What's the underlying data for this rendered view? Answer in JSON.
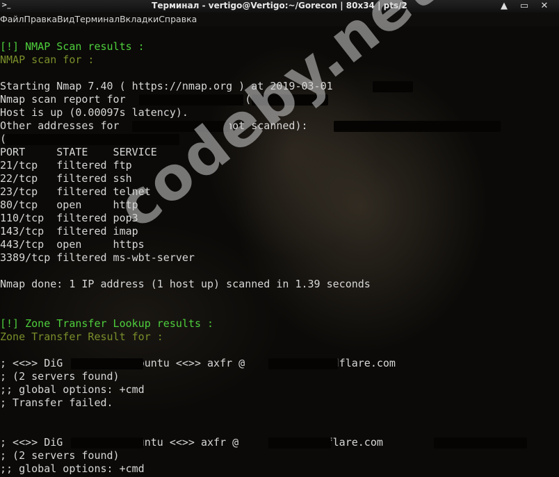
{
  "window": {
    "title": "Терминал - vertigo@Vertigo:~/Gorecon | 80x34 | pts/2",
    "icon": "terminal-icon",
    "controls": [
      "minimize-icon",
      "maximize-icon",
      "close-icon"
    ],
    "minimize_glyph": "▲",
    "maximize_glyph": "▭",
    "close_glyph": "✕",
    "app_glyph": ">_"
  },
  "menu": [
    "Файл",
    "Правка",
    "Вид",
    "Терминал",
    "Вкладки",
    "Справка"
  ],
  "colors": {
    "green": "#4ecf3c",
    "olive": "#7a8f2a",
    "text": "#d8d8d8",
    "background": "#0b0a08"
  },
  "terminal": {
    "lines": [
      {
        "text": "",
        "color": "w"
      },
      {
        "text": "[!] NMAP Scan results :",
        "color": "g"
      },
      {
        "text": "NMAP scan for :",
        "color": "y"
      },
      {
        "text": "",
        "color": "w"
      },
      {
        "text": "Starting Nmap 7.40 ( https://nmap.org ) at 2019-03-01       UTC",
        "color": "w"
      },
      {
        "text": "Nmap scan report for                   (          )",
        "color": "w"
      },
      {
        "text": "Host is up (0.00097s latency).",
        "color": "w"
      },
      {
        "text": "Other addresses for                (not scanned):",
        "color": "w"
      },
      {
        "text": "(",
        "color": "w"
      },
      {
        "text": "PORT     STATE    SERVICE",
        "color": "w"
      },
      {
        "text": "21/tcp   filtered ftp",
        "color": "w"
      },
      {
        "text": "22/tcp   filtered ssh",
        "color": "w"
      },
      {
        "text": "23/tcp   filtered telnet",
        "color": "w"
      },
      {
        "text": "80/tcp   open     http",
        "color": "w"
      },
      {
        "text": "110/tcp  filtered pop3",
        "color": "w"
      },
      {
        "text": "143/tcp  filtered imap",
        "color": "w"
      },
      {
        "text": "443/tcp  open     https",
        "color": "w"
      },
      {
        "text": "3389/tcp filtered ms-wbt-server",
        "color": "w"
      },
      {
        "text": "",
        "color": "w"
      },
      {
        "text": "Nmap done: 1 IP address (1 host up) scanned in 1.39 seconds",
        "color": "w"
      },
      {
        "text": "",
        "color": "w"
      },
      {
        "text": "",
        "color": "w"
      },
      {
        "text": "[!] Zone Transfer Lookup results :",
        "color": "g"
      },
      {
        "text": "Zone Transfer Result for :",
        "color": "y"
      },
      {
        "text": "",
        "color": "w"
      },
      {
        "text": "; <<>> DiG          -Ubuntu <<>> axfr @          cloudflare.com",
        "color": "w"
      },
      {
        "text": "; (2 servers found)",
        "color": "w"
      },
      {
        "text": ";; global options: +cmd",
        "color": "w"
      },
      {
        "text": "; Transfer failed.",
        "color": "w"
      },
      {
        "text": "",
        "color": "w"
      },
      {
        "text": "",
        "color": "w"
      },
      {
        "text": "; <<>> DiG          Ubuntu <<>> axfr @         cloudflare.com",
        "color": "w"
      },
      {
        "text": "; (2 servers found)",
        "color": "w"
      },
      {
        "text": ";; global options: +cmd",
        "color": "w"
      }
    ]
  },
  "watermark": "codeby.net"
}
